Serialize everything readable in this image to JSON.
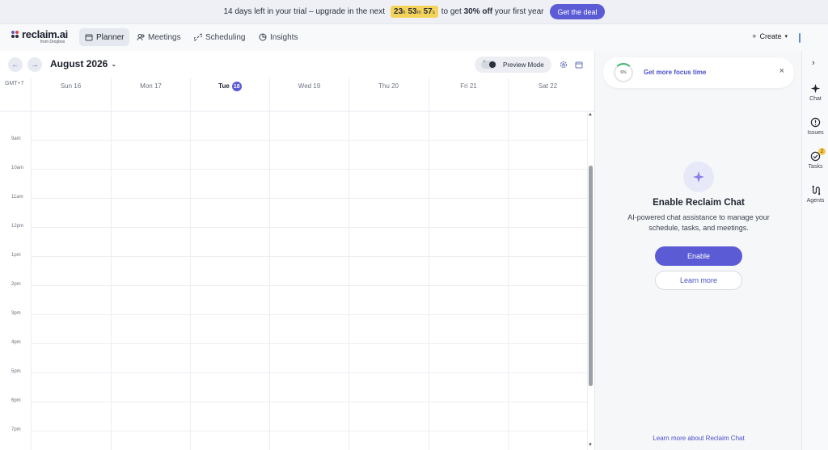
{
  "banner": {
    "text_before": "14 days left in your trial – upgrade in the next",
    "timer": {
      "h": "23",
      "h_unit": "h",
      "m": "53",
      "m_unit": "m",
      "s": "57",
      "s_unit": "s"
    },
    "text_mid": "to get",
    "offer": "30% off",
    "text_after": "your first year",
    "cta": "Get the deal"
  },
  "brand": {
    "name": "reclaim.ai",
    "sub": "from Dropbox"
  },
  "nav": {
    "tabs": [
      {
        "label": "Planner",
        "icon": "calendar-icon",
        "active": true
      },
      {
        "label": "Meetings",
        "icon": "people-icon"
      },
      {
        "label": "Scheduling",
        "icon": "link-icon"
      },
      {
        "label": "Insights",
        "icon": "chart-icon"
      }
    ],
    "create": "Create"
  },
  "calendar": {
    "month": "August 2026",
    "preview_mode": "Preview Mode",
    "timezone": "GMT+7",
    "days": [
      {
        "label": "Sun 16"
      },
      {
        "label": "Mon 17"
      },
      {
        "label": "Tue",
        "num": "18",
        "today": true
      },
      {
        "label": "Wed 19"
      },
      {
        "label": "Thu 20"
      },
      {
        "label": "Fri 21"
      },
      {
        "label": "Sat 22"
      }
    ],
    "hours": [
      "8am",
      "9am",
      "10am",
      "11am",
      "12pm",
      "1pm",
      "2pm",
      "3pm",
      "4pm",
      "5pm",
      "6pm",
      "7pm"
    ]
  },
  "panel": {
    "focus_percent": "6%",
    "focus_text": "Get more focus time",
    "chat_title": "Enable Reclaim Chat",
    "chat_desc": "AI-powered chat assistance to manage your schedule, tasks, and meetings.",
    "enable": "Enable",
    "learn_more": "Learn more",
    "learn_link": "Learn more about Reclaim Chat"
  },
  "rail": {
    "items": [
      {
        "label": "Chat"
      },
      {
        "label": "Issues"
      },
      {
        "label": "Tasks",
        "badge": "2"
      },
      {
        "label": "Agents"
      }
    ]
  },
  "colors": {
    "accent": "#5b5bd6",
    "timer": "#f5d35a",
    "badge": "#f5c74a"
  }
}
